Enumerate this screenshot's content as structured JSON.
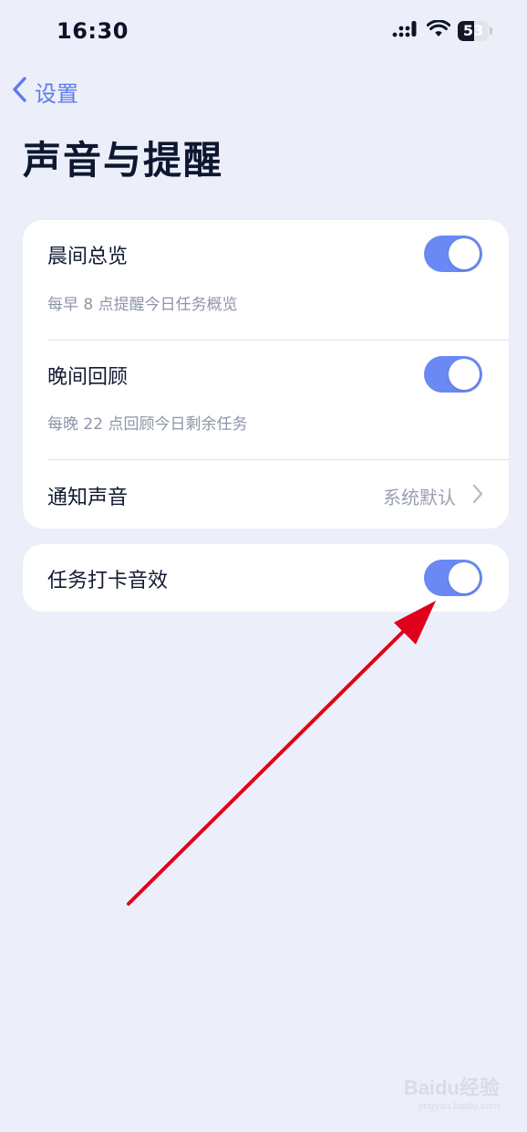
{
  "status_bar": {
    "time": "16:30",
    "battery_level": "53",
    "battery_fraction": 0.53
  },
  "nav": {
    "back_label": "设置"
  },
  "page": {
    "title": "声音与提醒"
  },
  "settings": {
    "morning_summary": {
      "label": "晨间总览",
      "description": "每早 8 点提醒今日任务概览",
      "enabled": true
    },
    "evening_review": {
      "label": "晚间回顾",
      "description": "每晚 22 点回顾今日剩余任务",
      "enabled": true
    },
    "notification_sound": {
      "label": "通知声音",
      "value": "系统默认"
    },
    "task_checkin_sound": {
      "label": "任务打卡音效",
      "enabled": true
    }
  },
  "colors": {
    "background": "#eceff9",
    "accent": "#5b7cf0",
    "toggle_on": "#6a89f4",
    "annotation_arrow": "#e0001b"
  },
  "watermark": {
    "logo_text": "Baidu经验",
    "sub_text": "jingyan.baidu.com"
  }
}
